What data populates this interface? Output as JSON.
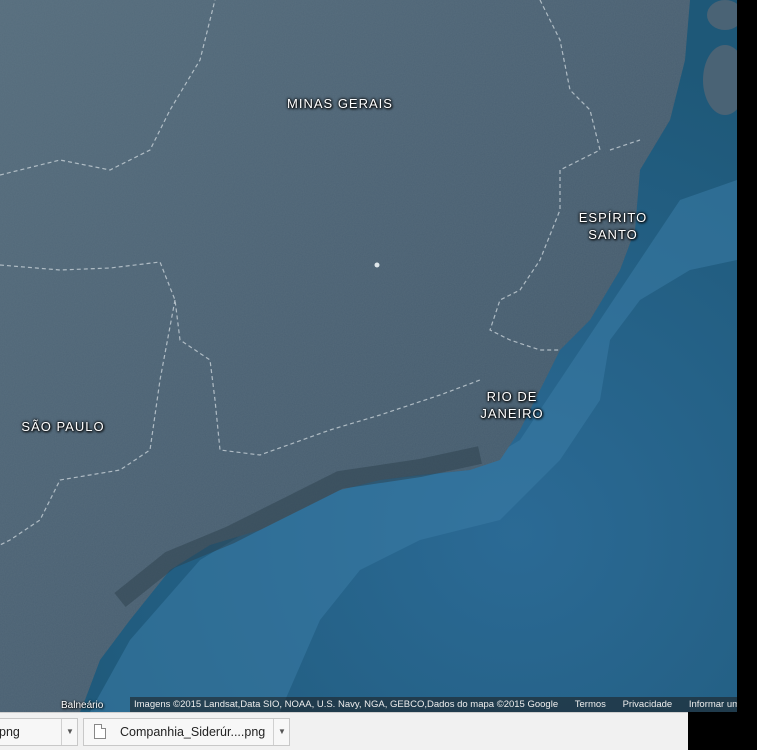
{
  "map": {
    "region_labels": [
      {
        "name": "MINAS GERAIS"
      },
      {
        "name": "ESPÍRITO\nSANTO"
      },
      {
        "name": "RIO DE\nJANEIRO"
      },
      {
        "name": "SÃO PAULO"
      }
    ],
    "city_label": "Balneário",
    "attribution": {
      "imagery": "Imagens ©2015 Landsat,Data SIO, NOAA, U.S. Navy, NGA, GEBCO,Dados do mapa ©2015 Google",
      "terms": "Termos",
      "privacy": "Privacidade",
      "report": "Informar um erro no mapa"
    },
    "colors": {
      "land": "#4b6273",
      "ocean": "#2f6f9a",
      "deep_ocean": "#1f5173"
    }
  },
  "downloads": {
    "items": [
      {
        "name": "png"
      },
      {
        "name": "Companhia_Siderúr....png"
      }
    ]
  }
}
